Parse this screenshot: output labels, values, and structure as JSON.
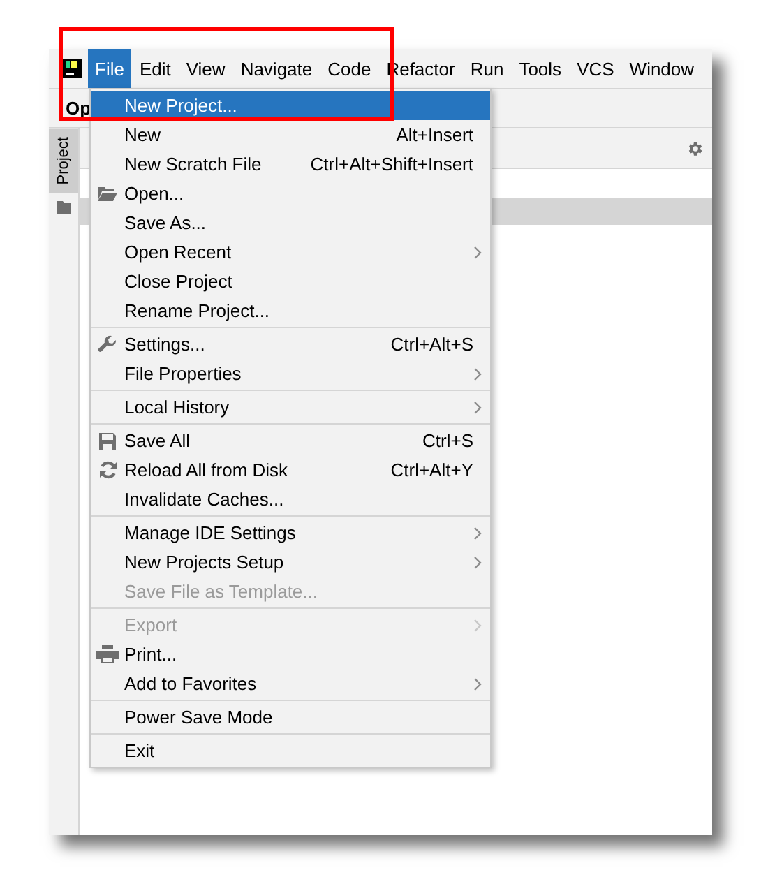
{
  "menubar": [
    {
      "label": "File",
      "selected": true
    },
    {
      "label": "Edit",
      "selected": false
    },
    {
      "label": "View",
      "selected": false
    },
    {
      "label": "Navigate",
      "selected": false
    },
    {
      "label": "Code",
      "selected": false
    },
    {
      "label": "Refactor",
      "selected": false
    },
    {
      "label": "Run",
      "selected": false
    },
    {
      "label": "Tools",
      "selected": false
    },
    {
      "label": "VCS",
      "selected": false
    },
    {
      "label": "Window",
      "selected": false
    }
  ],
  "toolbar": {
    "title": "Op"
  },
  "tool_window": {
    "label": "Project"
  },
  "file_menu": [
    [
      {
        "kind": "plain",
        "label": "New Project...",
        "selected": true,
        "disabled": false,
        "submenu": false
      },
      {
        "kind": "plain",
        "label": "New",
        "shortcut": "Alt+Insert",
        "selected": false,
        "disabled": false,
        "submenu": false
      },
      {
        "kind": "plain",
        "label": "New Scratch File",
        "shortcut": "Ctrl+Alt+Shift+Insert",
        "selected": false,
        "disabled": false,
        "submenu": false
      },
      {
        "kind": "folder",
        "label": "Open...",
        "selected": false,
        "disabled": false,
        "submenu": false
      },
      {
        "kind": "plain",
        "label": "Save As...",
        "selected": false,
        "disabled": false,
        "submenu": false
      },
      {
        "kind": "plain",
        "label": "Open Recent",
        "selected": false,
        "disabled": false,
        "submenu": true
      },
      {
        "kind": "plain",
        "label": "Close Project",
        "selected": false,
        "disabled": false,
        "submenu": false
      },
      {
        "kind": "plain",
        "label": "Rename Project...",
        "selected": false,
        "disabled": false,
        "submenu": false
      }
    ],
    [
      {
        "kind": "wrench",
        "label": "Settings...",
        "shortcut": "Ctrl+Alt+S",
        "selected": false,
        "disabled": false,
        "submenu": false
      },
      {
        "kind": "plain",
        "label": "File Properties",
        "selected": false,
        "disabled": false,
        "submenu": true
      }
    ],
    [
      {
        "kind": "plain",
        "label": "Local History",
        "selected": false,
        "disabled": false,
        "submenu": true
      }
    ],
    [
      {
        "kind": "disk",
        "label": "Save All",
        "shortcut": "Ctrl+S",
        "selected": false,
        "disabled": false,
        "submenu": false
      },
      {
        "kind": "reload",
        "label": "Reload All from Disk",
        "shortcut": "Ctrl+Alt+Y",
        "selected": false,
        "disabled": false,
        "submenu": false
      },
      {
        "kind": "plain",
        "label": "Invalidate Caches...",
        "selected": false,
        "disabled": false,
        "submenu": false
      }
    ],
    [
      {
        "kind": "plain",
        "label": "Manage IDE Settings",
        "selected": false,
        "disabled": false,
        "submenu": true
      },
      {
        "kind": "plain",
        "label": "New Projects Setup",
        "selected": false,
        "disabled": false,
        "submenu": true
      },
      {
        "kind": "plain",
        "label": "Save File as Template...",
        "selected": false,
        "disabled": true,
        "submenu": false
      }
    ],
    [
      {
        "kind": "plain",
        "label": "Export",
        "selected": false,
        "disabled": true,
        "submenu": true
      },
      {
        "kind": "printer",
        "label": "Print...",
        "selected": false,
        "disabled": false,
        "submenu": false
      },
      {
        "kind": "plain",
        "label": "Add to Favorites",
        "selected": false,
        "disabled": false,
        "submenu": true
      }
    ],
    [
      {
        "kind": "plain",
        "label": "Power Save Mode",
        "selected": false,
        "disabled": false,
        "submenu": false
      }
    ],
    [
      {
        "kind": "plain",
        "label": "Exit",
        "selected": false,
        "disabled": false,
        "submenu": false
      }
    ]
  ]
}
